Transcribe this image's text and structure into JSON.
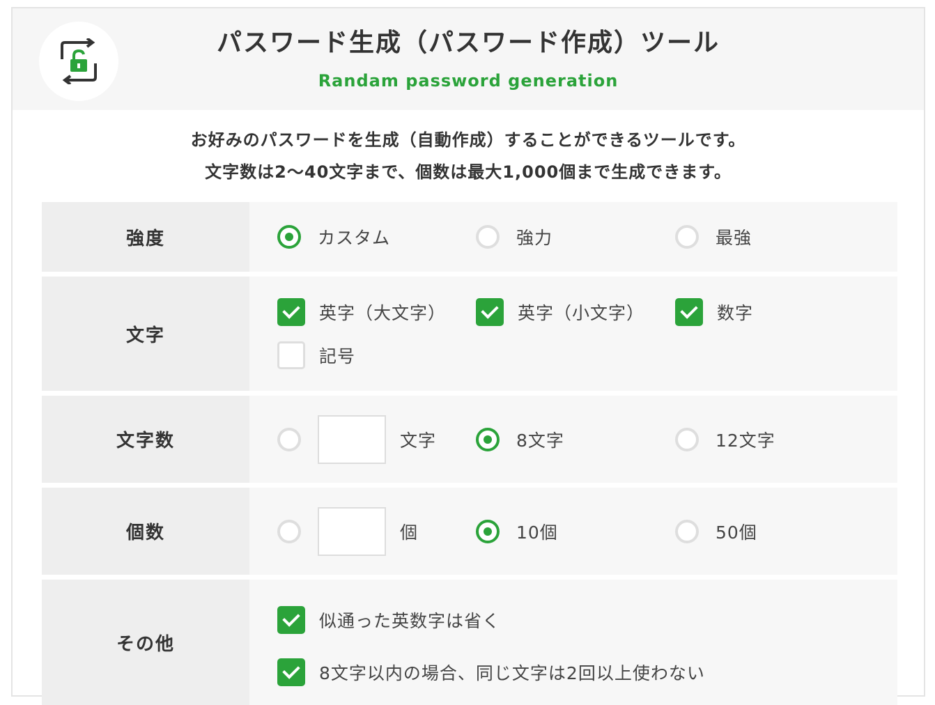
{
  "header": {
    "title": "パスワード生成（パスワード作成）ツール",
    "subtitle": "Randam password generation",
    "logo_icon": "lock-refresh-icon",
    "accent_color": "#2ba33a"
  },
  "intro": {
    "line1": "お好みのパスワードを生成（自動作成）することができるツールです。",
    "line2": "文字数は2〜40文字まで、個数は最大1,000個まで生成できます。"
  },
  "form": {
    "strength": {
      "label": "強度",
      "options": [
        {
          "label": "カスタム",
          "selected": true
        },
        {
          "label": "強力",
          "selected": false
        },
        {
          "label": "最強",
          "selected": false
        }
      ]
    },
    "chars": {
      "label": "文字",
      "options": [
        {
          "label": "英字（大文字）",
          "checked": true
        },
        {
          "label": "英字（小文字）",
          "checked": true
        },
        {
          "label": "数字",
          "checked": true
        },
        {
          "label": "記号",
          "checked": false
        }
      ]
    },
    "length": {
      "label": "文字数",
      "custom_unit": "文字",
      "custom_value": "",
      "options": [
        {
          "label": "8文字",
          "selected": true
        },
        {
          "label": "12文字",
          "selected": false
        }
      ]
    },
    "count": {
      "label": "個数",
      "custom_unit": "個",
      "custom_value": "",
      "options": [
        {
          "label": "10個",
          "selected": true
        },
        {
          "label": "50個",
          "selected": false
        }
      ]
    },
    "other": {
      "label": "その他",
      "options": [
        {
          "label": "似通った英数字は省く",
          "checked": true
        },
        {
          "label": "8文字以内の場合、同じ文字は2回以上使わない",
          "checked": true
        }
      ]
    }
  }
}
